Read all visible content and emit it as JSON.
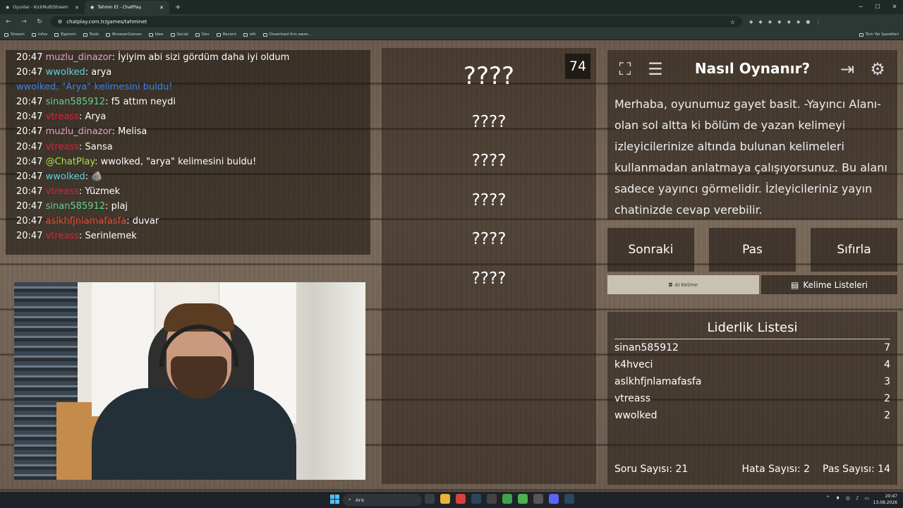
{
  "browser": {
    "tabs": [
      {
        "label": "Oyunlar - KickMultiStream",
        "active": false
      },
      {
        "label": "Tahmin Et - ChatPlay",
        "active": true
      }
    ],
    "new_tab": "+",
    "url": "chatplay.com.tr/games/tahminet",
    "bookmarks": [
      "Stream",
      "Infos",
      "Egemnt",
      "Tools",
      "BrowserGames",
      "Idee",
      "Social",
      "Dev",
      "Recent",
      "oth",
      "Download this awes..."
    ],
    "bookmarks_right": "Tüm Yer İşaretleri"
  },
  "chat": {
    "lines": [
      {
        "time": "20:47",
        "user": "muzlu_dinazor",
        "color": "#e8a0c8",
        "msg": ": İyiyim abi sizi gördüm daha iyi oldum"
      },
      {
        "time": "20:47",
        "user": "wwolked",
        "color": "#5fd3e0",
        "msg": ": arya"
      },
      {
        "time": "",
        "user": "wwolked, \"Arya\" kelimesini buldu!",
        "color": "#3b7fe0",
        "msg": ""
      },
      {
        "time": "20:47",
        "user": "sinan585912",
        "color": "#5fd38a",
        "msg": ": f5 attım neydi"
      },
      {
        "time": "20:47",
        "user": "vtreass",
        "color": "#d8243a",
        "msg": ": Arya"
      },
      {
        "time": "20:47",
        "user": "muzlu_dinazor",
        "color": "#e8a0c8",
        "msg": ": Melisa"
      },
      {
        "time": "20:47",
        "user": "vtreass",
        "color": "#d8243a",
        "msg": ": Sansa"
      },
      {
        "time": "20:47",
        "user": "@ChatPlay",
        "color": "#a8e04a",
        "msg": ": wwolked, \"arya\" kelimesini buldu!"
      },
      {
        "time": "20:47",
        "user": "wwolked",
        "color": "#5fd3e0",
        "msg": ": 🪨"
      },
      {
        "time": "20:47",
        "user": "vtreass",
        "color": "#d8243a",
        "msg": ": Yüzmek"
      },
      {
        "time": "20:47",
        "user": "sinan585912",
        "color": "#5fd38a",
        "msg": ": plaj"
      },
      {
        "time": "20:47",
        "user": "aslkhfjnlamafasfa",
        "color": "#e0503a",
        "msg": ": duvar"
      },
      {
        "time": "20:47",
        "user": "vtreass",
        "color": "#d8243a",
        "msg": ": Serinlemek"
      }
    ]
  },
  "words": {
    "counter": "74",
    "main": "????",
    "subs": [
      "????",
      "????",
      "????",
      "????",
      "????"
    ]
  },
  "howto": {
    "title": "Nasıl Oynanır?",
    "text": "Merhaba, oyunumuz gayet basit. -Yayıncı Alanı- olan sol altta ki bölüm de yazan kelimeyi izleyicilerinize altında bulunan kelimeleri kullanmadan anlatmaya çalışıyorsunuz. Bu alanı sadece yayıncı görmelidir. İzleyicileriniz yayın chatinizde cevap verebilir.",
    "icons": [
      "fullscreen-icon",
      "notes-icon",
      "exit-icon",
      "gear-icon"
    ]
  },
  "buttons": {
    "next": "Sonraki",
    "pass": "Pas",
    "reset": "Sıfırla",
    "ai": "AI Kelime",
    "lists": "Kelime Listeleri"
  },
  "leaderboard": {
    "title": "Liderlik Listesi",
    "rows": [
      {
        "name": "sinan585912",
        "score": "7"
      },
      {
        "name": "k4hveci",
        "score": "4"
      },
      {
        "name": "aslkhfjnlamafasfa",
        "score": "3"
      },
      {
        "name": "vtreass",
        "score": "2"
      },
      {
        "name": "wwolked",
        "score": "2"
      }
    ],
    "stats": {
      "questions": "Soru Sayısı: 21",
      "errors": "Hata Sayısı: 2",
      "passes": "Pas Sayısı: 14"
    }
  },
  "taskbar": {
    "search": "Ara",
    "time": "20:47",
    "date": "13.08.2026"
  }
}
